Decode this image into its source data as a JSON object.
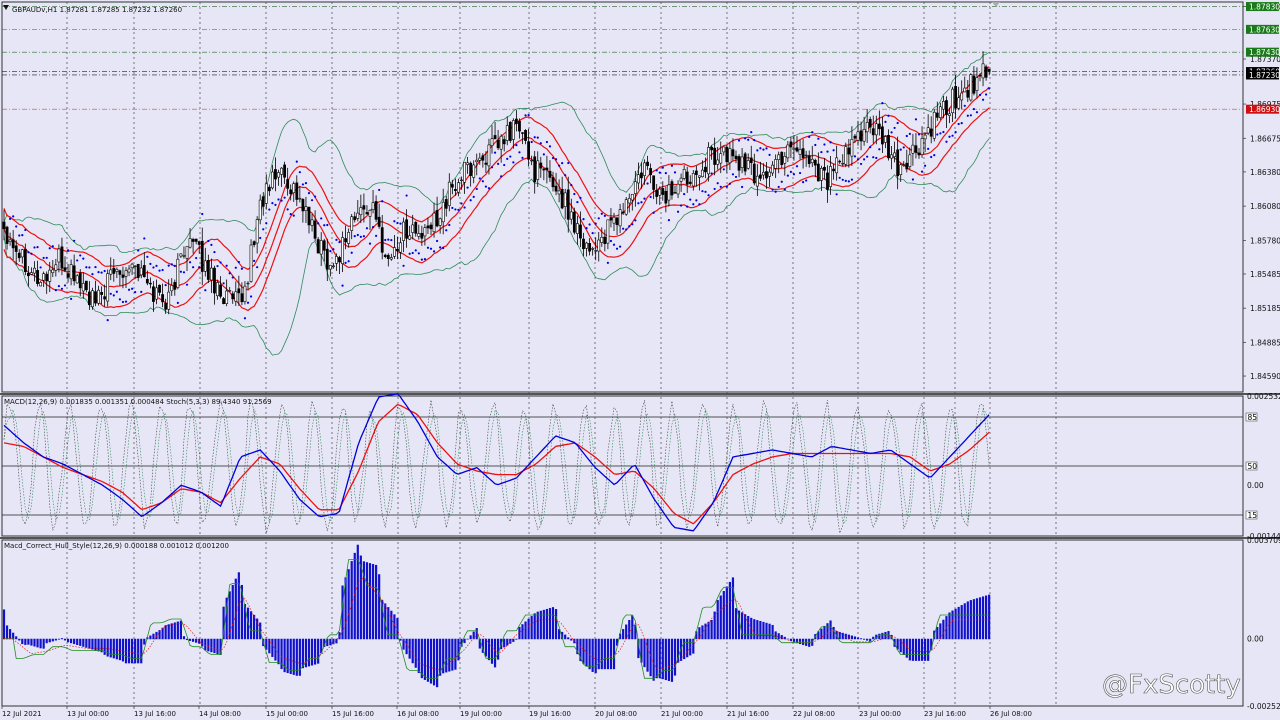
{
  "header": {
    "main_title": "GBPAUDv,H1  1.87281 1.87285 1.87232 1.87260",
    "macd_title": "MACD(12,26,9) 0.001835 0.001351 0.000484  Stoch(5,3,3) 89.4340 91.2569",
    "hull_title": "Macd_Correct_Hull_Style(12,26,9) 0.000188 0.001012 0.001200"
  },
  "watermark": "@FxScotty",
  "colors": {
    "background": "#e6e6f7",
    "macd_line": "#0000dd",
    "signal_line": "#ee1111",
    "bollinger": "#2e8b57",
    "envelope": "#ee1111",
    "psar_dots": "#0000dd",
    "hist_bars": "#1111cc",
    "hull_line": "#228b22",
    "tag_green": "#1a7a1a",
    "tag_red": "#d01010",
    "tag_black": "#000000"
  },
  "chart_data": [
    {
      "type": "candlestick",
      "title": "GBPAUDv,H1",
      "symbol": "GBPAUDv",
      "timeframe": "H1",
      "ohlc_last": {
        "open": 1.87281,
        "high": 1.87285,
        "low": 1.87232,
        "close": 1.8726
      },
      "ylim": [
        1.8445,
        1.8787
      ],
      "y_ticks": [
        "1.87830",
        "1.87370",
        "1.86975",
        "1.86675",
        "1.86380",
        "1.86080",
        "1.85780",
        "1.85485",
        "1.85185",
        "1.84885",
        "1.84590"
      ],
      "x_ticks": [
        "12 Jul 2021",
        "13 Jul 00:00",
        "13 Jul 16:00",
        "14 Jul 08:00",
        "15 Jul 00:00",
        "15 Jul 16:00",
        "16 Jul 08:00",
        "19 Jul 00:00",
        "19 Jul 16:00",
        "20 Jul 08:00",
        "21 Jul 00:00",
        "21 Jul 16:00",
        "22 Jul 08:00",
        "23 Jul 00:00",
        "23 Jul 16:00",
        "26 Jul 08:00"
      ],
      "price_tags": [
        {
          "label": "1.87830",
          "value": 1.8783,
          "style": "green"
        },
        {
          "label": "1.87630",
          "value": 1.8763,
          "style": "green"
        },
        {
          "label": "1.87430",
          "value": 1.8743,
          "style": "green"
        },
        {
          "label": "1.87260",
          "value": 1.8726,
          "style": "black"
        },
        {
          "label": "1.87230",
          "value": 1.8723,
          "style": "black"
        },
        {
          "label": "1.86930",
          "value": 1.8693,
          "style": "red"
        }
      ],
      "path_points": [
        [
          0,
          1.859
        ],
        [
          6,
          1.8565
        ],
        [
          12,
          1.8542
        ],
        [
          18,
          1.856
        ],
        [
          24,
          1.8545
        ],
        [
          30,
          1.852
        ],
        [
          36,
          1.855
        ],
        [
          42,
          1.856
        ],
        [
          48,
          1.8535
        ],
        [
          54,
          1.8525
        ],
        [
          60,
          1.8582
        ],
        [
          66,
          1.8555
        ],
        [
          72,
          1.853
        ],
        [
          78,
          1.852
        ],
        [
          84,
          1.861
        ],
        [
          90,
          1.864
        ],
        [
          96,
          1.862
        ],
        [
          102,
          1.858
        ],
        [
          108,
          1.8555
        ],
        [
          114,
          1.8595
        ],
        [
          120,
          1.861
        ],
        [
          126,
          1.856
        ],
        [
          132,
          1.859
        ],
        [
          138,
          1.858
        ],
        [
          144,
          1.861
        ],
        [
          150,
          1.8635
        ],
        [
          156,
          1.865
        ],
        [
          162,
          1.866
        ],
        [
          168,
          1.868
        ],
        [
          174,
          1.864
        ],
        [
          180,
          1.863
        ],
        [
          186,
          1.86
        ],
        [
          192,
          1.857
        ],
        [
          198,
          1.8585
        ],
        [
          204,
          1.861
        ],
        [
          210,
          1.864
        ],
        [
          216,
          1.8615
        ],
        [
          222,
          1.863
        ],
        [
          228,
          1.8645
        ],
        [
          234,
          1.8655
        ],
        [
          240,
          1.865
        ],
        [
          246,
          1.8635
        ],
        [
          252,
          1.864
        ],
        [
          258,
          1.8665
        ],
        [
          264,
          1.865
        ],
        [
          270,
          1.8632
        ],
        [
          276,
          1.865
        ],
        [
          282,
          1.868
        ],
        [
          288,
          1.8665
        ],
        [
          293,
          1.864
        ],
        [
          299,
          1.8655
        ],
        [
          305,
          1.868
        ],
        [
          311,
          1.87
        ],
        [
          317,
          1.8715
        ],
        [
          323,
          1.8726
        ]
      ]
    },
    {
      "type": "line",
      "title": "MACD(12,26,9)",
      "values_last": {
        "macd": 0.001835,
        "signal": 0.001351,
        "histogram": 0.000484
      },
      "ylim": [
        -0.001445,
        0.002532
      ],
      "y_ticks": [
        "0.002532",
        "0.00",
        "-0.001445"
      ],
      "series": [
        {
          "name": "MACD",
          "values": [
            0.0017,
            0.0012,
            0.0008,
            0.0006,
            0.0003,
            0.0,
            -0.0004,
            -0.0009,
            -0.0005,
            0.0,
            -0.0002,
            -0.0006,
            0.0008,
            0.001,
            0.0004,
            -0.0004,
            -0.0009,
            -0.0008,
            0.0012,
            0.0025,
            0.0026,
            0.0018,
            0.0008,
            0.0003,
            0.0005,
            0.0,
            0.0002,
            0.0008,
            0.0014,
            0.0012,
            0.0005,
            0.0,
            0.0006,
            -0.0004,
            -0.0012,
            -0.0013,
            -0.0005,
            0.0008,
            0.0009,
            0.001,
            0.0009,
            0.0008,
            0.0011,
            0.001,
            0.0009,
            0.001,
            0.0006,
            0.0002,
            0.0008,
            0.0014,
            0.002
          ]
        },
        {
          "name": "Signal",
          "values": [
            0.0012,
            0.0011,
            0.0008,
            0.0005,
            0.0003,
            0.0001,
            -0.0002,
            -0.0007,
            -0.0005,
            -0.0001,
            -0.0002,
            -0.0005,
            0.0002,
            0.0008,
            0.0006,
            -0.0001,
            -0.0007,
            -0.0007,
            0.0004,
            0.0018,
            0.0023,
            0.002,
            0.0012,
            0.0006,
            0.0004,
            0.0003,
            0.0003,
            0.0006,
            0.0011,
            0.0012,
            0.0008,
            0.0003,
            0.0004,
            -0.0001,
            -0.0008,
            -0.0011,
            -0.0005,
            0.0003,
            0.0006,
            0.0008,
            0.0009,
            0.0009,
            0.0009,
            0.0009,
            0.0009,
            0.0009,
            0.0008,
            0.0004,
            0.0006,
            0.001,
            0.0015
          ]
        }
      ]
    },
    {
      "type": "line",
      "title": "Stoch(5,3,3)",
      "values_last": {
        "main": 89.434,
        "signal": 91.2569
      },
      "levels": [
        {
          "label": "85",
          "value": 85
        },
        {
          "label": "50",
          "value": 50
        },
        {
          "label": "15",
          "value": 15
        }
      ],
      "ylim": [
        0,
        100
      ]
    },
    {
      "type": "bar",
      "title": "Macd_Correct_Hull_Style(12,26,9)",
      "values_last": {
        "a": 0.000188,
        "b": 0.001012,
        "c": 0.0012
      },
      "ylim": [
        -0.002526,
        0.003709
      ],
      "y_ticks": [
        "0.003709",
        "0.00",
        "-0.002526"
      ]
    }
  ]
}
